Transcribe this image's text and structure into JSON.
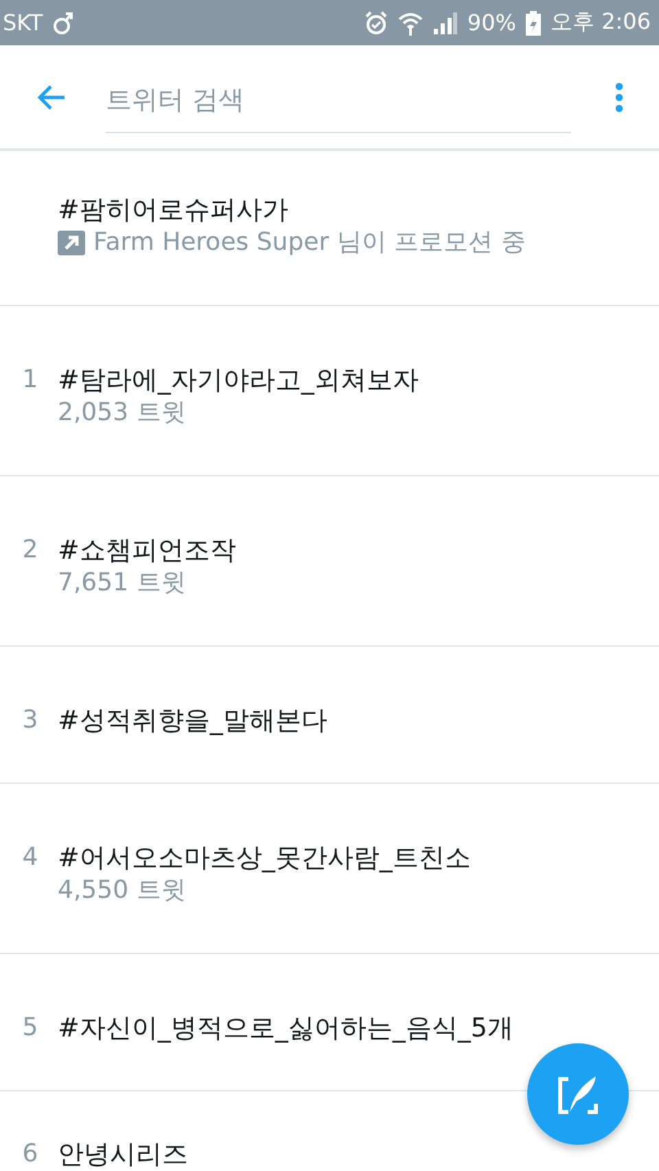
{
  "status_bar": {
    "carrier": "SKT",
    "battery": "90%",
    "time": "오후 2:06"
  },
  "search": {
    "placeholder": "트위터 검색"
  },
  "trends": [
    {
      "kind": "promoted",
      "title": "#팜히어로슈퍼사가",
      "subtitle": "Farm Heroes Super 님이 프로모션 중"
    },
    {
      "kind": "ranked",
      "rank": "1",
      "title": "#탐라에_자기야라고_외쳐보자",
      "subtitle": "2,053 트윗"
    },
    {
      "kind": "ranked",
      "rank": "2",
      "title": "#쇼챔피언조작",
      "subtitle": "7,651 트윗"
    },
    {
      "kind": "ranked",
      "rank": "3",
      "title": "#성적취향을_말해본다"
    },
    {
      "kind": "ranked",
      "rank": "4",
      "title": "#어서오소마츠상_못간사람_트친소",
      "subtitle": "4,550 트윗"
    },
    {
      "kind": "ranked",
      "rank": "5",
      "title": "#자신이_병적으로_싫어하는_음식_5개"
    },
    {
      "kind": "ranked",
      "rank": "6",
      "title": "안녕시리즈"
    }
  ]
}
